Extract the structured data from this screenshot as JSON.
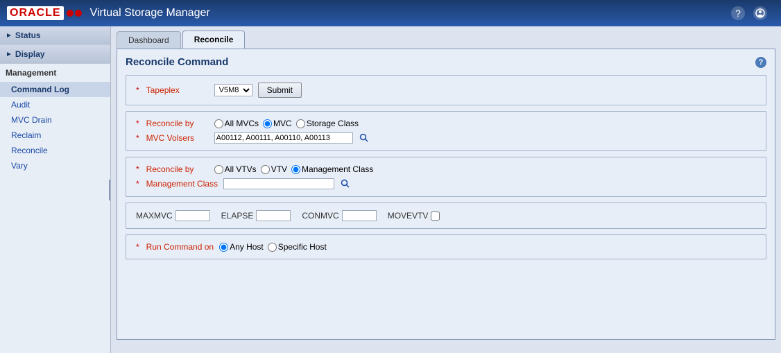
{
  "header": {
    "app_title": "Virtual Storage Manager",
    "oracle_logo": "ORACLE",
    "help_icon": "?",
    "user_icon": "○"
  },
  "sidebar": {
    "status_label": "Status",
    "display_label": "Display",
    "management_label": "Management",
    "items": [
      {
        "id": "command-log",
        "label": "Command Log",
        "active": true
      },
      {
        "id": "audit",
        "label": "Audit",
        "active": false
      },
      {
        "id": "mvc-drain",
        "label": "MVC Drain",
        "active": false
      },
      {
        "id": "reclaim",
        "label": "Reclaim",
        "active": false
      },
      {
        "id": "reconcile",
        "label": "Reconcile",
        "active": false
      },
      {
        "id": "vary",
        "label": "Vary",
        "active": false
      }
    ]
  },
  "tabs": [
    {
      "id": "dashboard",
      "label": "Dashboard",
      "active": false
    },
    {
      "id": "reconcile",
      "label": "Reconcile",
      "active": true
    }
  ],
  "page": {
    "title": "Reconcile Command",
    "tapeplex_label": "Tapeplex",
    "tapeplex_value": "V5M8",
    "submit_label": "Submit",
    "reconcile_by_label": "Reconcile by",
    "reconcile_by_options": [
      "All MVCs",
      "MVC",
      "Storage Class"
    ],
    "reconcile_by_selected": "MVC",
    "mvc_volsers_label": "MVC Volsers",
    "mvc_volsers_value": "A00112, A00111, A00110, A00113",
    "reconcile_by2_label": "Reconcile by",
    "reconcile_by2_options": [
      "All VTVs",
      "VTV",
      "Management Class"
    ],
    "reconcile_by2_selected": "Management Class",
    "management_class_label": "Management Class",
    "management_class_value": "",
    "maxmvc_label": "MAXMVC",
    "maxmvc_value": "",
    "elapse_label": "ELAPSE",
    "elapse_value": "",
    "conmvc_label": "CONMVC",
    "conmvc_value": "",
    "movevtv_label": "MOVEVTV",
    "movevtv_checked": false,
    "run_command_label": "Run Command on",
    "run_command_options": [
      "Any Host",
      "Specific Host"
    ],
    "run_command_selected": "Any Host",
    "help_icon": "?"
  }
}
